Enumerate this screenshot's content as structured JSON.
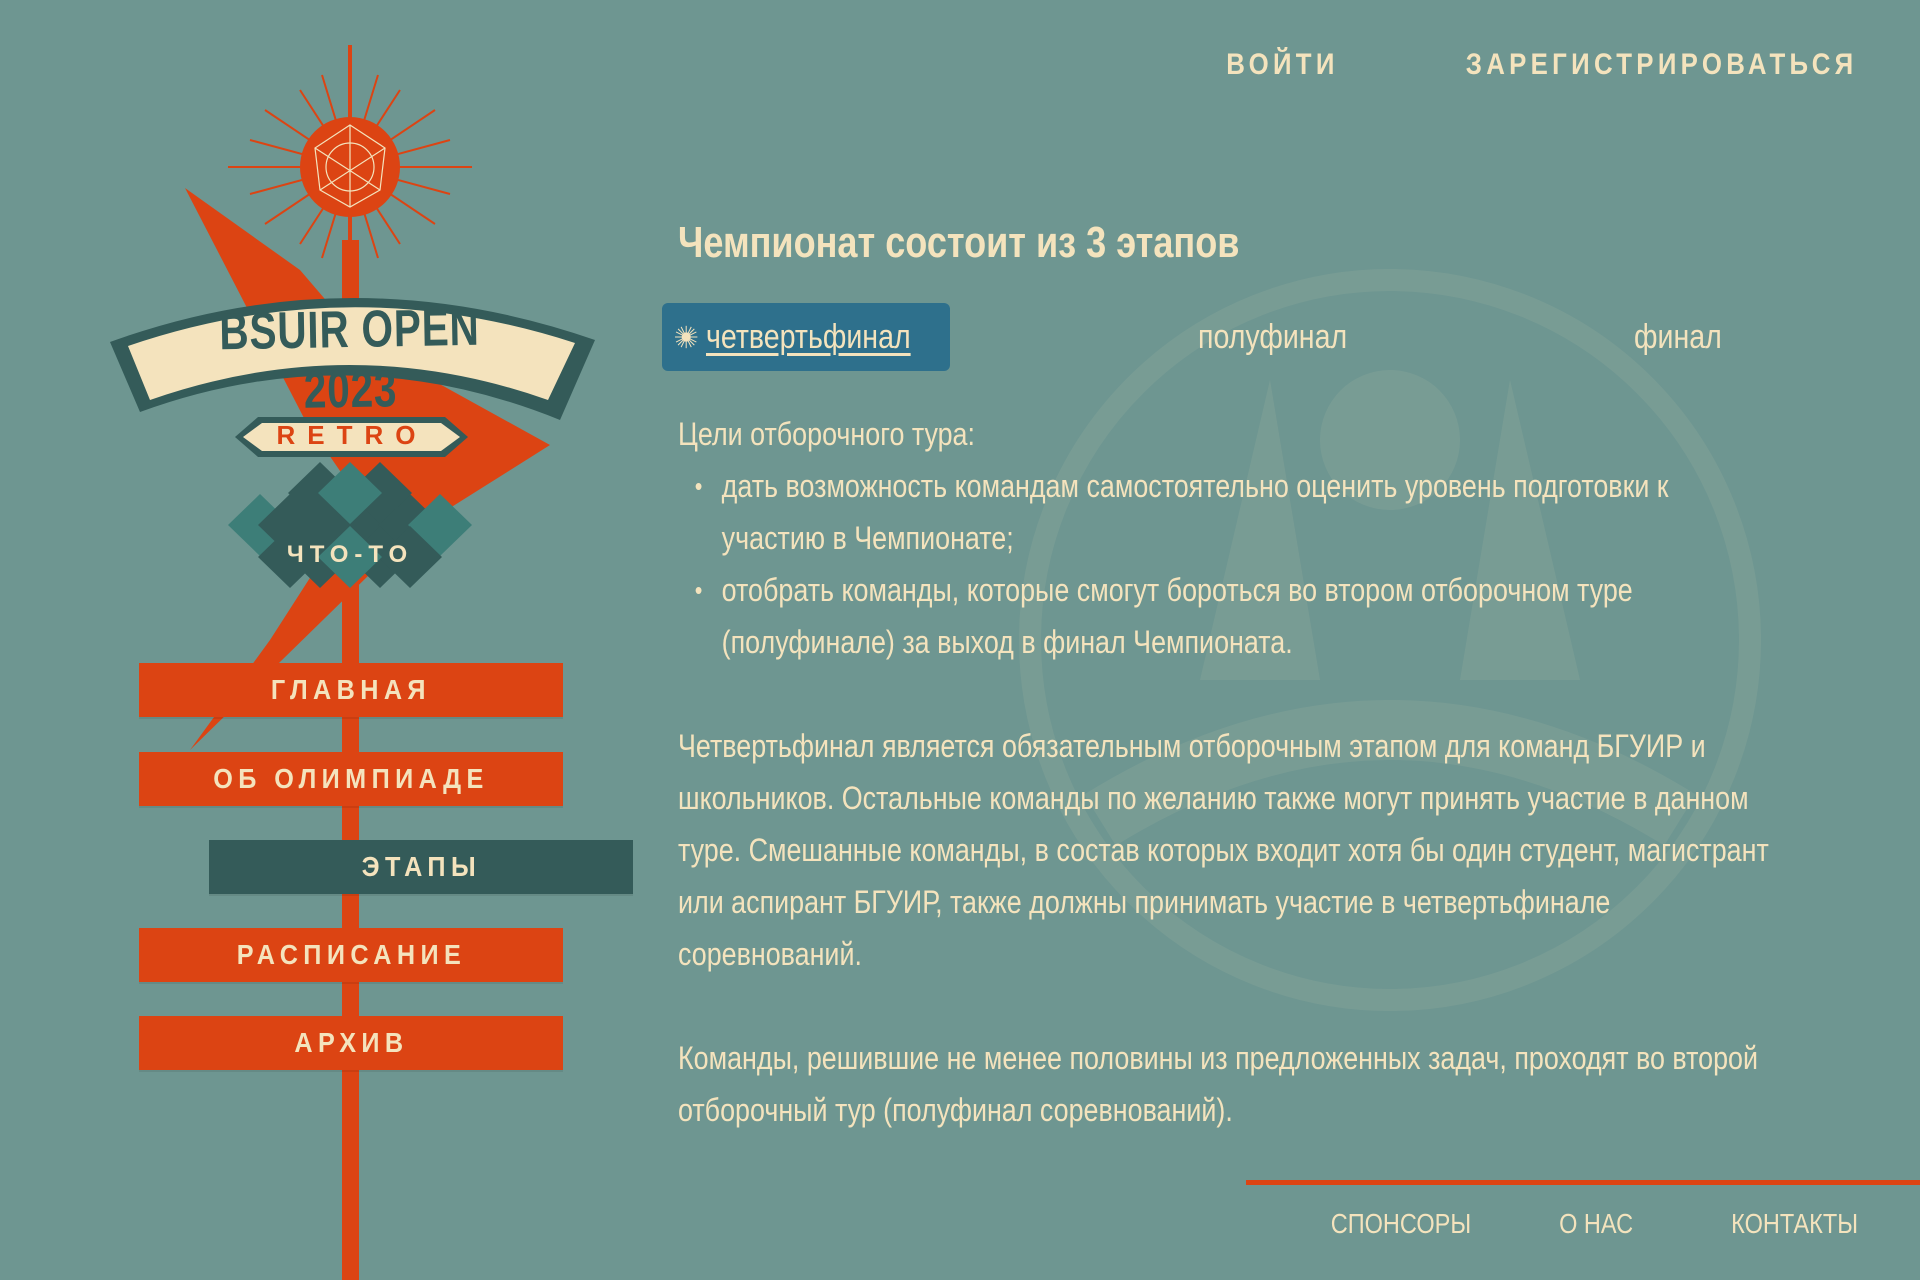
{
  "header": {
    "login_label": "ВОЙТИ",
    "register_label": "ЗАРЕГИСТРИРОВАТЬСЯ"
  },
  "logo": {
    "title": "BSUIR OPEN 2023",
    "subtitle": "RETRO",
    "tag": "ЧТО-ТО"
  },
  "menu": {
    "items": [
      {
        "label": "ГЛАВНАЯ"
      },
      {
        "label": "ОБ ОЛИМПИАДЕ"
      },
      {
        "label": "ЭТАПЫ"
      },
      {
        "label": "РАСПИСАНИЕ"
      },
      {
        "label": "АРХИВ"
      }
    ],
    "active_index": 2
  },
  "main": {
    "title": "Чемпионат состоит из 3 этапов",
    "tabs": [
      {
        "label": "четвертьфинал"
      },
      {
        "label": "полуфинал"
      },
      {
        "label": "финал"
      }
    ],
    "active_tab": 0,
    "goals_heading": "Цели отборочного тура:",
    "goals": [
      "дать возможность командам самостоятельно оценить уровень подготовки к участию в Чемпионате;",
      "отобрать команды, которые смогут бороться во втором отборочном туре (полуфинале) за выход в финал Чемпионата."
    ],
    "paragraph1": "Четвертьфинал является обязательным отборочным этапом для команд БГУИР и школьников. Остальные команды по желанию также могут принять участие в данном туре. Смешанные команды, в состав которых входит хотя бы один студент, магистрант или аспирант БГУИР, также должны принимать участие в четвертьфинале соревнований.",
    "paragraph2": "Команды, решившие не менее половины из предложенных задач, проходят во второй отборочный тур (полуфинал соревнований)."
  },
  "footer": {
    "sponsors_label": "СПОНСОРЫ",
    "about_label": "О НАС",
    "contacts_label": "КОНТАКТЫ"
  },
  "colors": {
    "background": "#6e9691",
    "accent": "#dc4413",
    "cream": "#f4e3bd",
    "dark_teal": "#345b59",
    "tab_active": "#2e708c"
  },
  "icons": {
    "active_tab_icon": "sunburst-icon",
    "logo_icon": "atomic-starburst-icon"
  }
}
